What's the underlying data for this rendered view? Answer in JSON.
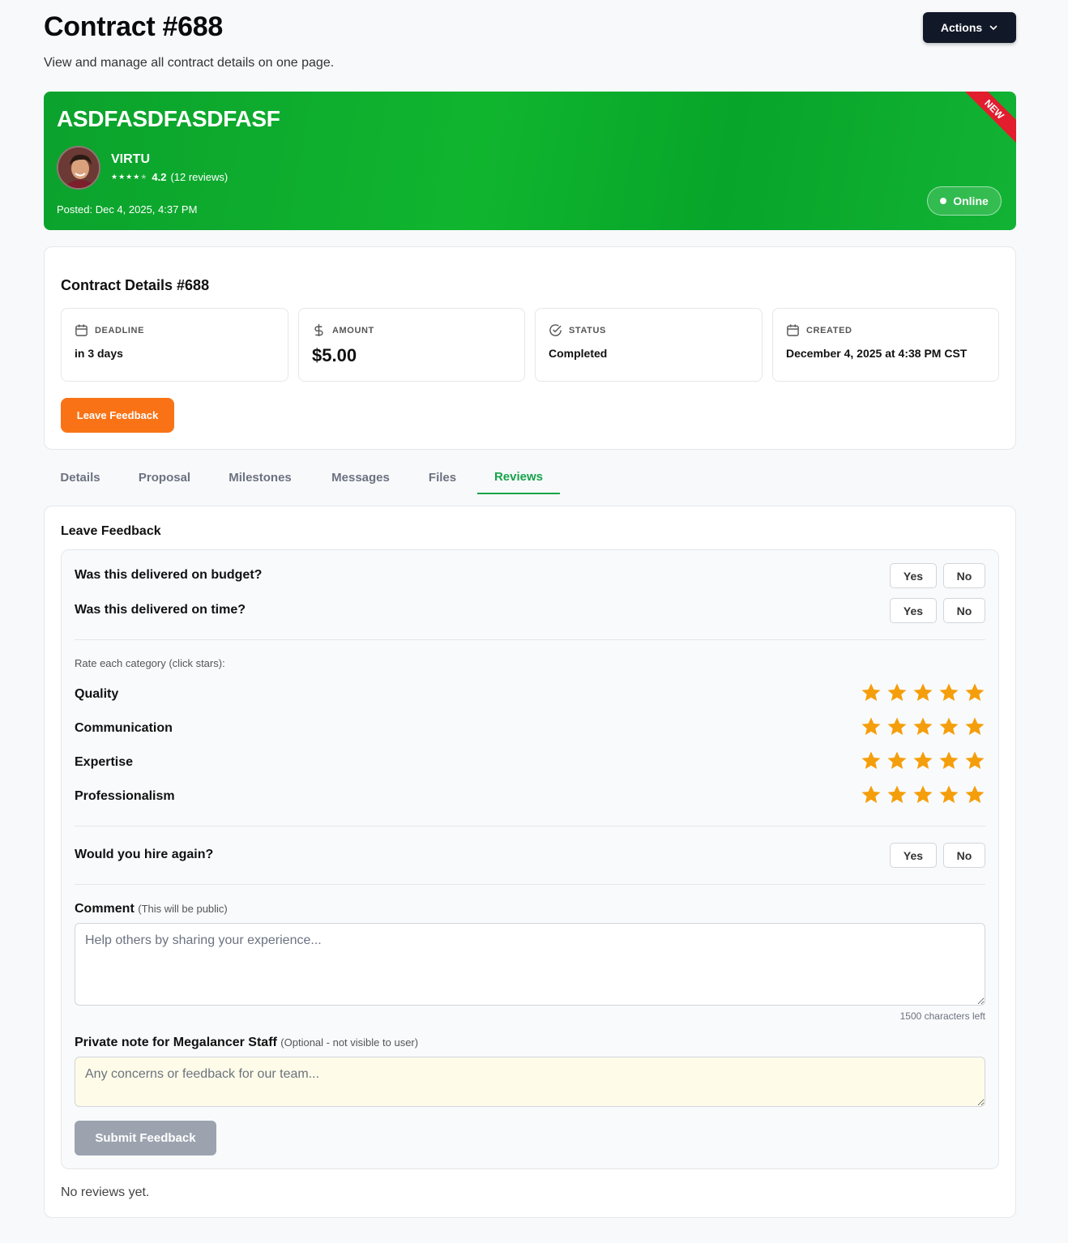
{
  "header": {
    "title": "Contract #688",
    "subtitle": "View and manage all contract details on one page.",
    "actions_label": "Actions"
  },
  "hero": {
    "title": "ASDFASDFASDFASF",
    "ribbon": "NEW",
    "user_name": "VIRTU",
    "rating_value": "4.2",
    "rating_count": "(12 reviews)",
    "rating_stars": 4,
    "posted": "Posted: Dec 4, 2025, 4:37 PM",
    "status_badge": "Online",
    "colors": {
      "accent": "#0ba22d",
      "ribbon": "#e11d2e"
    }
  },
  "details": {
    "heading": "Contract Details #688",
    "stats": [
      {
        "label": "DEADLINE",
        "value": "in 3 days",
        "icon": "calendar-icon"
      },
      {
        "label": "AMOUNT",
        "value": "$5.00",
        "icon": "dollar-icon"
      },
      {
        "label": "STATUS",
        "value": "Completed",
        "icon": "check-circle-icon"
      },
      {
        "label": "CREATED",
        "value": "December 4, 2025 at 4:38 PM CST",
        "icon": "calendar-icon"
      }
    ],
    "leave_feedback_label": "Leave Feedback"
  },
  "tabs": [
    {
      "label": "Details",
      "active": false
    },
    {
      "label": "Proposal",
      "active": false
    },
    {
      "label": "Milestones",
      "active": false
    },
    {
      "label": "Messages",
      "active": false
    },
    {
      "label": "Files",
      "active": false
    },
    {
      "label": "Reviews",
      "active": true
    }
  ],
  "feedback": {
    "heading": "Leave Feedback",
    "questions": [
      {
        "text": "Was this delivered on budget?",
        "yes": "Yes",
        "no": "No"
      },
      {
        "text": "Was this delivered on time?",
        "yes": "Yes",
        "no": "No"
      }
    ],
    "rate_hint": "Rate each category (click stars):",
    "categories": [
      {
        "name": "Quality",
        "rating": 5
      },
      {
        "name": "Communication",
        "rating": 5
      },
      {
        "name": "Expertise",
        "rating": 5
      },
      {
        "name": "Professionalism",
        "rating": 5
      }
    ],
    "hire_again": {
      "text": "Would you hire again?",
      "yes": "Yes",
      "no": "No"
    },
    "comment": {
      "label": "Comment",
      "note": "(This will be public)",
      "placeholder": "Help others by sharing your experience...",
      "chars_left": "1500 characters left"
    },
    "private_note": {
      "label": "Private note for Megalancer Staff",
      "note": "(Optional - not visible to user)",
      "placeholder": "Any concerns or feedback for our team..."
    },
    "submit_label": "Submit Feedback",
    "star_color": "#f59e0b"
  },
  "reviews_empty": "No reviews yet."
}
